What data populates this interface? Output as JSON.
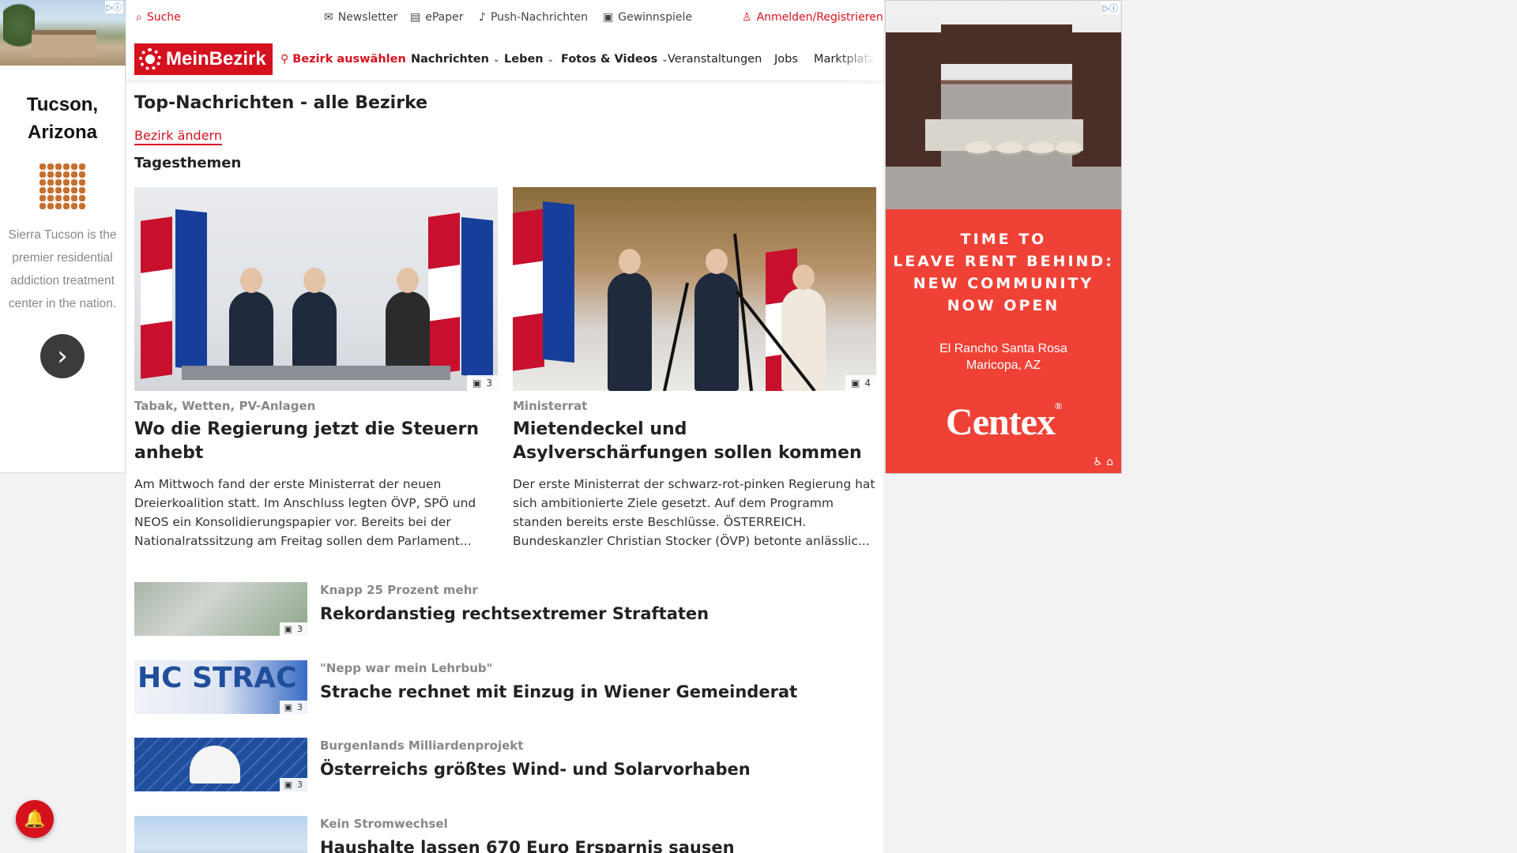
{
  "left_ad": {
    "adchoices_label": "▷ⓘ",
    "city": "Tucson, Arizona",
    "description": "Sierra Tucson is the premier residential addiction treatment center in the nation.",
    "cta_icon": "chevron-right-icon"
  },
  "utility": {
    "search": "Suche",
    "newsletter": "Newsletter",
    "epaper": "ePaper",
    "push": "Push-Nachrichten",
    "contests": "Gewinnspiele",
    "login": "Anmelden/Registrieren"
  },
  "nav": {
    "logo": "MeinBezirk",
    "select_district": "Bezirk auswählen",
    "items": [
      "Nachrichten",
      "Leben",
      "Fotos & Videos",
      "Veranstaltungen",
      "Jobs",
      "Marktplatz"
    ]
  },
  "main": {
    "title": "Top-Nachrichten - alle Bezirke",
    "change_district": "Bezirk ändern",
    "section": "Tagesthemen"
  },
  "cards": [
    {
      "kicker": "Tabak, Wetten, PV-Anlagen",
      "headline": "Wo die Regierung jetzt die Steuern anhebt",
      "teaser": "Am Mittwoch fand der erste Ministerrat der neuen Dreierkoalition statt. Im Anschluss legten ÖVP, SPÖ und NEOS ein Konsolidierungspapier vor. Bereits bei der Nationalratssitzung am Freitag sollen dem Parlament...",
      "image_count": "3"
    },
    {
      "kicker": "Ministerrat",
      "headline": "Mietendeckel und Asylverschärfungen sollen kommen",
      "teaser": "Der erste Ministerrat der schwarz-rot-pinken Regierung hat sich ambitionierte Ziele gesetzt. Auf dem Programm standen bereits erste Beschlüsse. ÖSTERREICH. Bundeskanzler Christian Stocker (ÖVP) betonte anlässlic...",
      "image_count": "4"
    }
  ],
  "list": [
    {
      "kicker": "Knapp 25 Prozent mehr",
      "headline": "Rekordanstieg rechtsextremer Straftaten",
      "image_count": "3"
    },
    {
      "kicker": "\"Nepp war mein Lehrbub\"",
      "headline": "Strache rechnet mit Einzug in Wiener Gemeinderat",
      "image_count": "3",
      "thumb_text": "HC STRAC"
    },
    {
      "kicker": "Burgenlands Milliardenprojekt",
      "headline": "Österreichs größtes Wind- und Solarvorhaben",
      "image_count": "3"
    },
    {
      "kicker": "Kein Stromwechsel",
      "headline": "Haushalte lassen 670 Euro Ersparnis sausen",
      "image_count": ""
    }
  ],
  "right_ad": {
    "adchoices_label": "▷ⓘ",
    "headline_lines": [
      "TIME TO",
      "LEAVE RENT BEHIND:",
      "NEW COMMUNITY",
      "NOW OPEN"
    ],
    "location_lines": [
      "El Rancho Santa Rosa",
      "Maricopa, AZ"
    ],
    "brand": "Centex",
    "brand_mark": "®",
    "icons": "♿ ⌂"
  },
  "colors": {
    "brand_red": "#d6111e",
    "ad_red": "#ef4136"
  }
}
